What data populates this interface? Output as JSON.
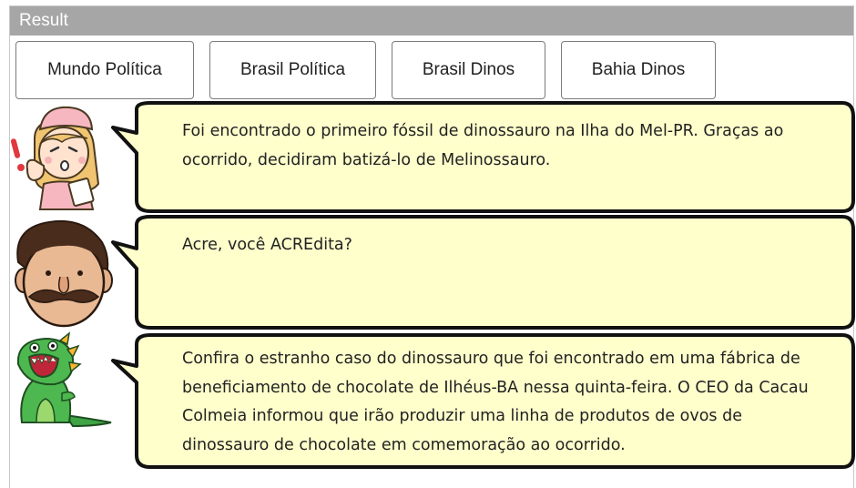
{
  "window": {
    "title": "Result"
  },
  "tabs": [
    {
      "label": "Mundo Política"
    },
    {
      "label": "Brasil Política"
    },
    {
      "label": "Brasil Dinos"
    },
    {
      "label": "Bahia Dinos"
    }
  ],
  "messages": [
    {
      "avatar": "nurse-avatar",
      "text": "Foi encontrado o primeiro fóssil de dinossauro na Ilha do Mel-PR. Graças ao ocorrido, decidiram batizá-lo de Melinossauro."
    },
    {
      "avatar": "mustache-man-avatar",
      "text": "Acre, você ACREdita?"
    },
    {
      "avatar": "dinosaur-avatar",
      "text": "Confira o estranho caso do dinossauro que foi encontrado em uma fábrica de beneficiamento de chocolate de Ilhéus-BA nessa quinta-feira. O CEO da Cacau Colmeia informou que irão produzir uma linha de produtos de ovos de dinossauro de chocolate em comemoração ao ocorrido."
    }
  ],
  "colors": {
    "bubble_fill": "#ffffcc",
    "bubble_stroke": "#111111",
    "titlebar": "#a6a6a6"
  }
}
